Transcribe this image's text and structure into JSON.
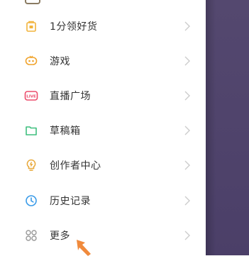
{
  "menu": {
    "items": [
      {
        "label": "1分领好货",
        "icon": "shopping-bag-icon",
        "color": "#f2b43c"
      },
      {
        "label": "游戏",
        "icon": "game-controller-icon",
        "color": "#f0a32b"
      },
      {
        "label": "直播广场",
        "icon": "live-icon",
        "color": "#ec4c6c"
      },
      {
        "label": "草稿箱",
        "icon": "folder-icon",
        "color": "#3fbf7f"
      },
      {
        "label": "创作者中心",
        "icon": "lightbulb-icon",
        "color": "#e8a83a"
      },
      {
        "label": "历史记录",
        "icon": "clock-icon",
        "color": "#3a9be8"
      },
      {
        "label": "更多",
        "icon": "grid-icon",
        "color": "#999999"
      }
    ],
    "live_badge_text": "LIVE"
  },
  "colors": {
    "backdrop": "#4b3f68",
    "chevron": "#cccccc",
    "hint_arrow": "#f08a3c"
  }
}
